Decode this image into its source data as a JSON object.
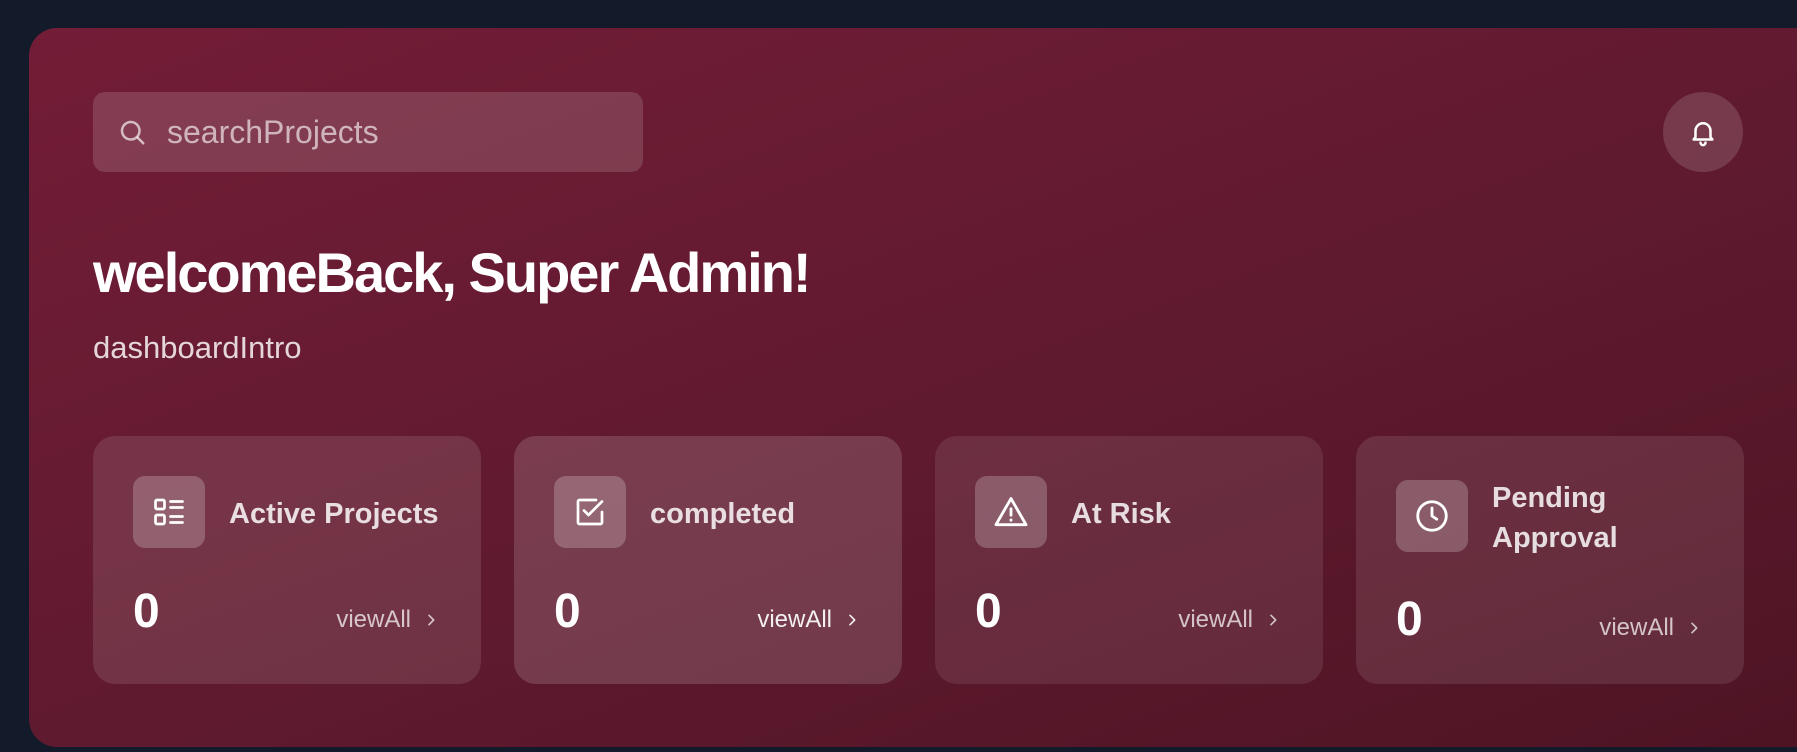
{
  "search": {
    "placeholder": "searchProjects",
    "value": ""
  },
  "header": {
    "title": "welcomeBack, Super Admin!",
    "intro": "dashboardIntro"
  },
  "cards": [
    {
      "label": "Active Projects",
      "count": "0",
      "link": "viewAll",
      "icon": "list-icon"
    },
    {
      "label": "completed",
      "count": "0",
      "link": "viewAll",
      "icon": "check-square-icon"
    },
    {
      "label": "At Risk",
      "count": "0",
      "link": "viewAll",
      "icon": "warning-icon"
    },
    {
      "label": "Pending Approval",
      "count": "0",
      "link": "viewAll",
      "icon": "clock-icon"
    }
  ],
  "colors": {
    "page_bg": "#131a2a",
    "hero_start": "#731d37",
    "hero_end": "#4e1424",
    "text": "#ffffff"
  }
}
